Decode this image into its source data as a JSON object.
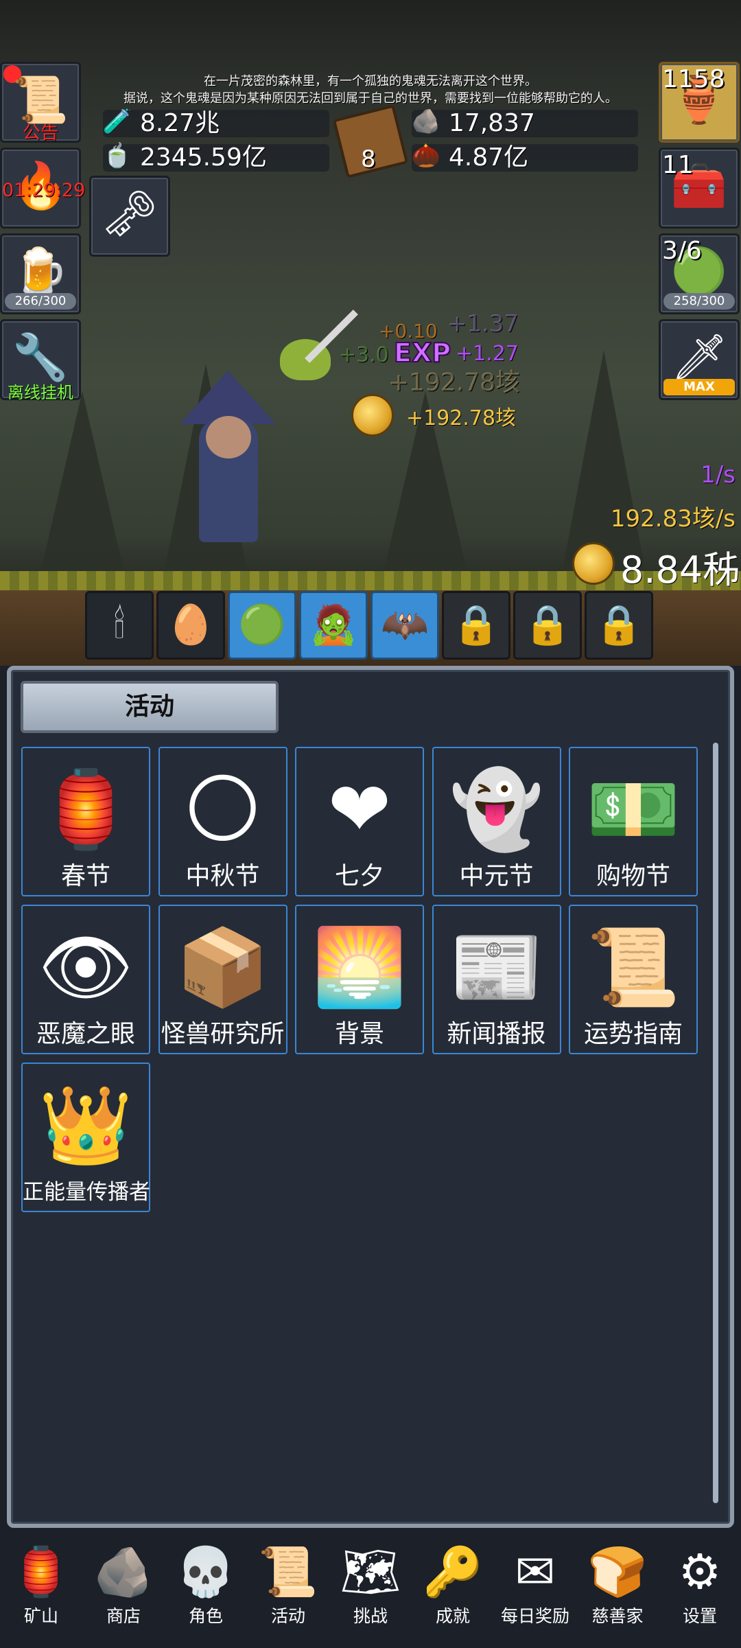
{
  "story": {
    "line1": "在一片茂密的森林里，有一个孤独的鬼魂无法离开这个世界。",
    "line2": "据说，这个鬼魂是因为某种原因无法回到属于自己的世界，需要找到一位能够帮助它的人。"
  },
  "left_tiles": {
    "notice_label": "公告",
    "timer": "01:29:29",
    "beer_progress": "266/300",
    "offline_label": "离线挂机"
  },
  "resources": {
    "blue_potion": "8.27兆",
    "green_potion": "2345.59亿",
    "book_count": "8",
    "stone": "17,837",
    "seed": "4.87亿"
  },
  "right_tiles": {
    "potion_count": "1158",
    "chest_count": "11",
    "slime_count": "3/6",
    "slime_progress": "258/300",
    "sword_status": "MAX"
  },
  "combat": {
    "float_top": "+1.37",
    "float_small": "+0.10",
    "float_green": "+3.0",
    "exp_label": "EXP",
    "exp_value": "+1.27",
    "float_ghost": "+192.78垓",
    "coin_gain": "+192.78垓",
    "rate_per_sec": "1/s",
    "gold_per_sec": "192.83垓/s",
    "gold_total": "8.84秭"
  },
  "monsters": [
    {
      "icon": "🕯",
      "state": "normal"
    },
    {
      "icon": "🥚",
      "state": "normal"
    },
    {
      "icon": "🟢",
      "state": "active"
    },
    {
      "icon": "🧟",
      "state": "active"
    },
    {
      "icon": "🦇",
      "state": "active"
    },
    {
      "icon": "🔒",
      "state": "locked"
    },
    {
      "icon": "🔒",
      "state": "locked"
    },
    {
      "icon": "🔒",
      "state": "locked"
    }
  ],
  "panel": {
    "tab_title": "活动",
    "events": [
      {
        "label": "春节",
        "icon": "🏮"
      },
      {
        "label": "中秋节",
        "icon": "🌕"
      },
      {
        "label": "七夕",
        "icon": "❤"
      },
      {
        "label": "中元节",
        "icon": "👻"
      },
      {
        "label": "购物节",
        "icon": "💵"
      },
      {
        "label": "恶魔之眼",
        "icon": "👁"
      },
      {
        "label": "怪兽研究所",
        "icon": "📦"
      },
      {
        "label": "背景",
        "icon": "🌅"
      },
      {
        "label": "新闻播报",
        "icon": "📰"
      },
      {
        "label": "运势指南",
        "icon": "📜"
      },
      {
        "label": "正能量传播者",
        "icon": "👑"
      }
    ]
  },
  "nav": [
    {
      "label": "矿山",
      "icon": "🏮"
    },
    {
      "label": "商店",
      "icon": "🪨"
    },
    {
      "label": "角色",
      "icon": "💀"
    },
    {
      "label": "活动",
      "icon": "📜"
    },
    {
      "label": "挑战",
      "icon": "🗺"
    },
    {
      "label": "成就",
      "icon": "🔑"
    },
    {
      "label": "每日奖励",
      "icon": "✉"
    },
    {
      "label": "慈善家",
      "icon": "🍞"
    },
    {
      "label": "设置",
      "icon": "⚙"
    }
  ],
  "colors": {
    "tab_border": "#3b86d6",
    "active_monster": "#3a8ed6",
    "gold_text": "#f4c542",
    "exp_text": "#b04cff",
    "alert_red": "#ff2a2a"
  }
}
